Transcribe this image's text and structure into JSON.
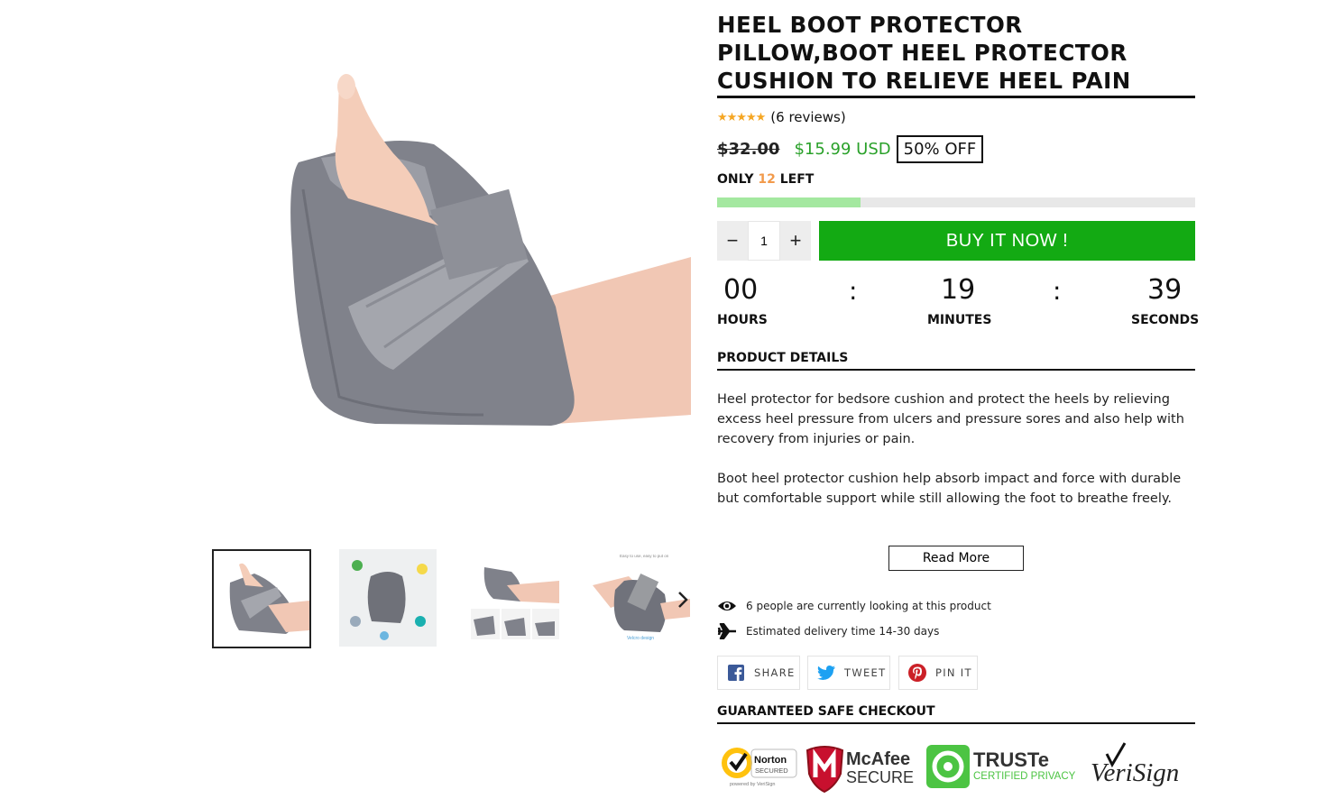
{
  "product": {
    "title": "HEEL BOOT PROTECTOR PILLOW,BOOT HEEL PROTECTOR CUSHION TO RELIEVE HEEL PAIN",
    "rating_stars": "★★★★★",
    "reviews": "(6 reviews)",
    "old_price": "$32.00",
    "new_price": "$15.99 USD",
    "discount": "50% OFF"
  },
  "stock": {
    "prefix": "ONLY",
    "count": "12",
    "suffix": "LEFT",
    "fraction_remaining": 0.3
  },
  "purchase": {
    "quantity": "1",
    "minus": "−",
    "plus": "+",
    "buy_label": "BUY IT NOW !"
  },
  "timer": {
    "hours": "00",
    "hours_label": "HOURS",
    "minutes": "19",
    "minutes_label": "MINUTES",
    "seconds": "39",
    "seconds_label": "SECONDS",
    "separator": ":"
  },
  "details": {
    "heading": "PRODUCT DETAILS",
    "paragraph1": "Heel protector for bedsore cushion and protect the heels by relieving excess heel pressure from ulcers and pressure sores and also help with recovery from injuries or pain.",
    "paragraph2": "Boot heel protector cushion help absorb impact and force with durable but comfortable support while still allowing the foot to breathe freely.",
    "read_more": "Read More"
  },
  "info": {
    "viewers": "6 people are currently looking at this product",
    "delivery": "Estimated delivery time 14-30 days"
  },
  "share": {
    "facebook": "SHARE",
    "twitter": "TWEET",
    "pinterest": "PIN IT"
  },
  "checkout": {
    "heading": "GUARANTEED SAFE CHECKOUT",
    "norton_line1": "Norton",
    "norton_line2": "SECURED",
    "norton_line3": "powered by VeriSign",
    "mcafee_line1": "McAfee",
    "mcafee_line2": "SECURE",
    "truste_line1": "TRUSTe",
    "truste_line2": "CERTIFIED PRIVACY",
    "verisign": "VeriSign"
  },
  "gallery": {
    "thumb4_caption_top": "Easy to use, easy to put on",
    "thumb4_caption_bottom": "Velcro design"
  },
  "colors": {
    "buy_green": "#13aa13",
    "sale_green": "#2aa12a",
    "stock_orange": "#f29a4b",
    "stock_bar_fill": "#a4e8a0",
    "cushion_grey": "#7e8089"
  }
}
